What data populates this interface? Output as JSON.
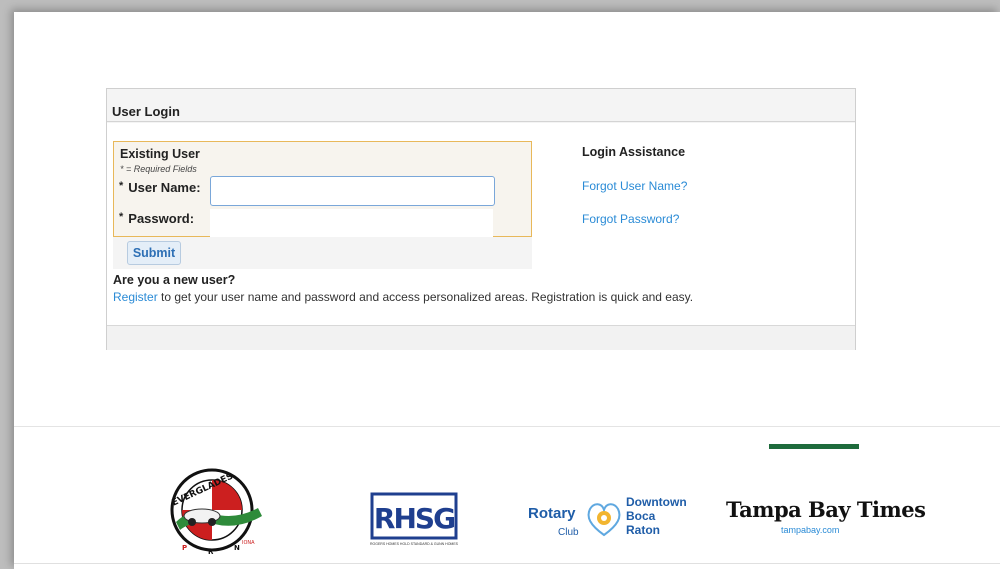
{
  "login": {
    "title": "User Login",
    "existing": {
      "title": "Existing User",
      "required_note": "* = Required Fields",
      "required_mark": "*",
      "username_label": "User Name:",
      "username_value": "",
      "password_label": "Password:",
      "password_value": "",
      "submit_label": "Submit"
    },
    "new_user": {
      "title": "Are you a new user?",
      "register_link": "Register",
      "text": " to get your user name and password and access personalized areas. Registration is quick and easy."
    },
    "assistance": {
      "title": "Login Assistance",
      "forgot_username": "Forgot User Name?",
      "forgot_password": "Forgot Password?"
    }
  },
  "sponsors": {
    "everglades": {
      "name": "EVERGLADES",
      "sub_left": "P",
      "sub_mid": "R",
      "sub_right": "N",
      "tag": "IONA"
    },
    "rhsg": {
      "name": "RHSG",
      "caption": "ROGERS HOMES HOLD STANDARD & GUNN HOMES"
    },
    "rotary": {
      "name": "Rotary",
      "club": "Club",
      "city_line1": "Downtown",
      "city_line2": "Boca",
      "city_line3": "Raton"
    },
    "tampa": {
      "name": "Tampa Bay Times",
      "url": "tampabay.com"
    }
  },
  "colors": {
    "link": "#2a8bd6",
    "highlight_border": "#e8b85a",
    "accent_green": "#1e6b3c",
    "rotary_blue": "#1f5da8"
  }
}
